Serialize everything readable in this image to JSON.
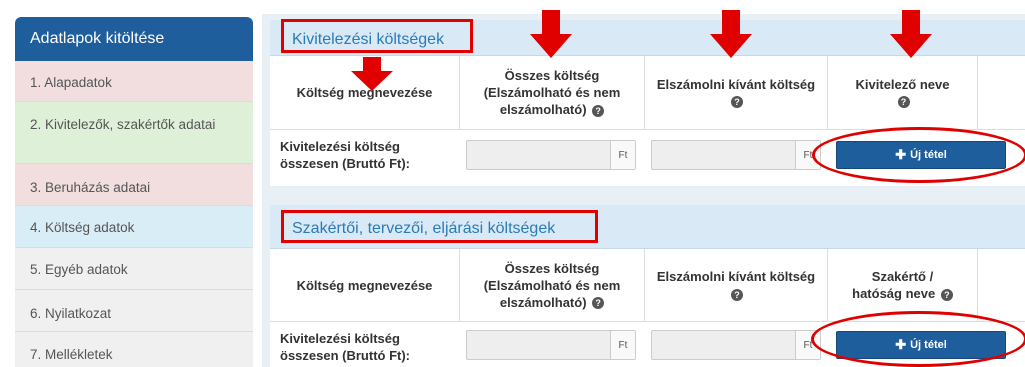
{
  "sidebar": {
    "title": "Adatlapok kitöltése",
    "items": [
      {
        "label": "1. Alapadatok",
        "state": "red"
      },
      {
        "label": "2. Kivitelezők, szakértők adatai",
        "state": "green"
      },
      {
        "label": "3. Beruházás adatai",
        "state": "red"
      },
      {
        "label": "4. Költség adatok",
        "state": "blue"
      },
      {
        "label": "5. Egyéb adatok",
        "state": "gray"
      },
      {
        "label": "6. Nyilatkozat",
        "state": "gray"
      },
      {
        "label": "7. Mellékletek",
        "state": "gray"
      }
    ]
  },
  "panels": [
    {
      "title": "Kivitelezési költségek",
      "headers": {
        "col1": "Költség megnevezése",
        "col2": "Összes költség (Elszámolható és nem elszámolható)",
        "col3": "Elszámolni kívánt költség",
        "col4": "Kivitelező neve"
      },
      "row": {
        "label": "Kivitelezési költség összesen (Bruttó Ft):",
        "total_value": "",
        "claim_value": "",
        "currency1": "Ft",
        "currency2": "Ft",
        "button": "Új tétel"
      }
    },
    {
      "title": "Szakértői, tervezői, eljárási költségek",
      "headers": {
        "col1": "Költség megnevezése",
        "col2": "Összes költség (Elszámolható és nem elszámolható)",
        "col3": "Elszámolni kívánt költség",
        "col4": "Szakértő / hatóság neve"
      },
      "row": {
        "label": "Kivitelezési költség összesen (Bruttó Ft):",
        "total_value": "",
        "claim_value": "",
        "currency1": "Ft",
        "currency2": "Ft",
        "button": "Új tétel"
      }
    }
  ],
  "icons": {
    "help": "question-circle-icon",
    "plus": "plus-icon",
    "arrow": "down-arrow-icon"
  },
  "colors": {
    "sidebar_header": "#1f5e9c",
    "panel_title_bg": "#d9eaf6",
    "panel_title_text": "#2b7bb5",
    "button": "#1f5e9c",
    "annotation": "#e00000"
  }
}
